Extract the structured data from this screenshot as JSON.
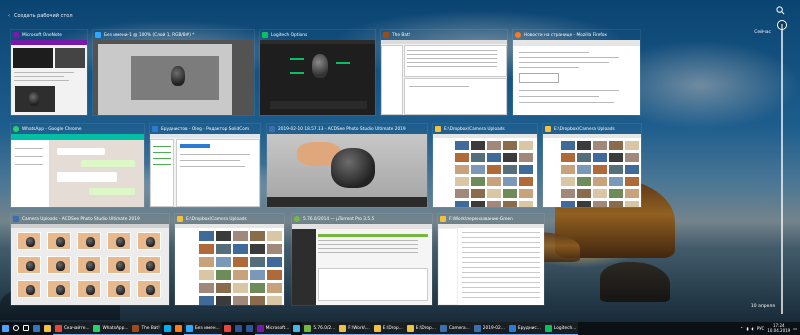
{
  "desktop": {
    "new_desktop_label": "Создать рабочий стол"
  },
  "timeline": {
    "today_label": "Сейчас",
    "date_label": "10 апреля"
  },
  "windows": [
    {
      "title": "Microsoft OneNote",
      "icon": "onenote-icon",
      "color": "#7719aa"
    },
    {
      "title": "Без имени-1 @ 100% (Слой 1, RGB/8#) *",
      "icon": "photoshop-icon",
      "color": "#31a8ff"
    },
    {
      "title": "Logitech Options",
      "icon": "logitech-icon",
      "color": "#0abf60"
    },
    {
      "title": "The Bat!",
      "icon": "thebat-icon",
      "color": "#9b4a1c"
    },
    {
      "title": "Новости на странице - Mozilla Firefox",
      "icon": "firefox-icon",
      "color": "#ff7a1a"
    },
    {
      "title": "WhatsApp - Google Chrome",
      "icon": "chrome-icon",
      "color": "#25d366"
    },
    {
      "title": "Еруднистов - Oleg - Редактор SolidCom",
      "icon": "editor-icon",
      "color": "#2c7bd4"
    },
    {
      "title": "2019-02-10 18.57.13 - ACDSee Photo Studio Ultimate 2019",
      "icon": "acdsee-icon",
      "color": "#3a6fb0"
    },
    {
      "title": "E:\\Dropbox\\Camera Uploads",
      "icon": "folder-icon",
      "color": "#f0c040"
    },
    {
      "title": "E:\\Dropbox\\Camera Uploads",
      "icon": "folder-icon",
      "color": "#f0c040"
    },
    {
      "title": "Camera Uploads - ACDSee Photo Studio Ultimate 2019",
      "icon": "acdsee-icon",
      "color": "#3a6fb0"
    },
    {
      "title": "E:\\Dropbox\\Camera Uploads",
      "icon": "folder-icon",
      "color": "#f0c040"
    },
    {
      "title": "5.76.0/2014 — µTorrent Pro 3.5.5",
      "icon": "utorrent-icon",
      "color": "#76b83f"
    },
    {
      "title": "F:\\Work\\переназвание-Green",
      "icon": "folder-icon",
      "color": "#f0c040"
    }
  ],
  "taskbar": {
    "items": [
      {
        "label": "",
        "icon": "windows-start-icon",
        "color": "#4aa3ff"
      },
      {
        "label": "",
        "icon": "search-icon",
        "color": "#ffffff"
      },
      {
        "label": "",
        "icon": "task-view-icon",
        "color": "#ffffff"
      },
      {
        "label": "",
        "icon": "edge-icon",
        "color": "#3277bc"
      },
      {
        "label": "",
        "icon": "folder-icon",
        "color": "#f0c040"
      },
      {
        "label": "Скачайте...",
        "icon": "chrome-icon",
        "color": "#e8453c"
      },
      {
        "label": "WhatsApp...",
        "icon": "chrome-icon",
        "color": "#25d366"
      },
      {
        "label": "The Bat!",
        "icon": "thebat-icon",
        "color": "#9b4a1c"
      },
      {
        "label": "",
        "icon": "skype-icon",
        "color": "#00aff0"
      },
      {
        "label": "",
        "icon": "firefox-icon",
        "color": "#ff7a1a"
      },
      {
        "label": "Без имен...",
        "icon": "photoshop-icon",
        "color": "#31a8ff"
      },
      {
        "label": "",
        "icon": "chrome-icon",
        "color": "#e8453c"
      },
      {
        "label": "",
        "icon": "word-icon",
        "color": "#2b579a"
      },
      {
        "label": "",
        "icon": "word-icon",
        "color": "#2b579a"
      },
      {
        "label": "Microsoft...",
        "icon": "onenote-icon",
        "color": "#7719aa"
      },
      {
        "label": "",
        "icon": "app-icon",
        "color": "#46b6e8"
      },
      {
        "label": "5.76.0/2...",
        "icon": "utorrent-icon",
        "color": "#76b83f"
      },
      {
        "label": "F:\\Work\\...",
        "icon": "folder-icon",
        "color": "#f0c040"
      },
      {
        "label": "E:\\Drop...",
        "icon": "folder-icon",
        "color": "#f0c040"
      },
      {
        "label": "E:\\Drop...",
        "icon": "folder-icon",
        "color": "#f0c040"
      },
      {
        "label": "Camera...",
        "icon": "acdsee-icon",
        "color": "#3a6fb0"
      },
      {
        "label": "2019-02...",
        "icon": "acdsee-icon",
        "color": "#3a6fb0"
      },
      {
        "label": "Еруднис...",
        "icon": "editor-icon",
        "color": "#2c7bd4"
      },
      {
        "label": "Logitech...",
        "icon": "logitech-icon",
        "color": "#0abf60"
      }
    ],
    "tray": {
      "language": "РУС",
      "time": "17:24",
      "date": "10.04.2019"
    }
  }
}
